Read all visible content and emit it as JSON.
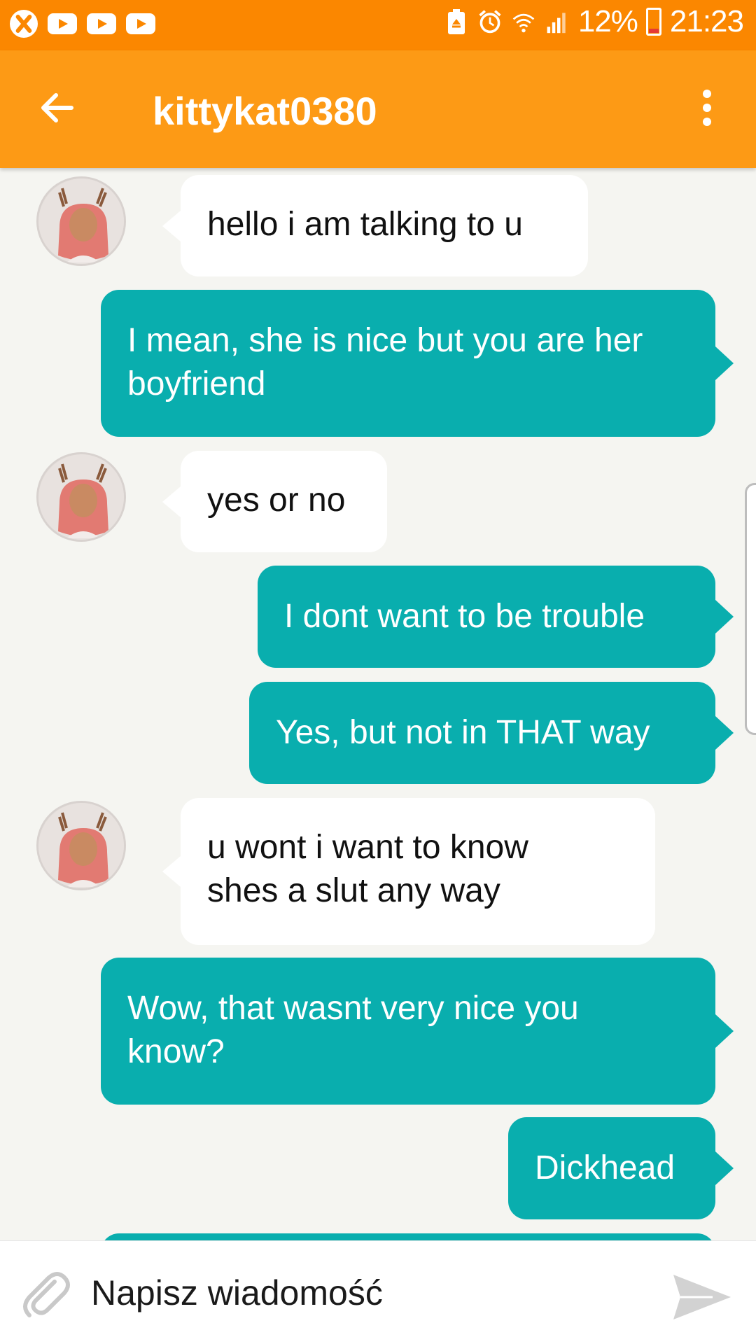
{
  "status_bar": {
    "battery_percent": "12%",
    "time": "21:23",
    "left_icons": [
      "xbox-icon",
      "youtube-icon",
      "youtube-icon",
      "youtube-icon"
    ],
    "right_icons": [
      "battery-saver-icon",
      "alarm-icon",
      "wifi-icon",
      "signal-icon",
      "battery-icon"
    ]
  },
  "header": {
    "title": "kittykat0380",
    "back_icon": "arrow-left-icon",
    "menu_icon": "more-vertical-icon"
  },
  "messages": [
    {
      "direction": "in",
      "text": "hello i am talking to u"
    },
    {
      "direction": "out",
      "text": "I mean, she is nice but you are her boyfriend"
    },
    {
      "direction": "in",
      "text": "yes or no"
    },
    {
      "direction": "out",
      "text": "I dont want to be trouble"
    },
    {
      "direction": "out",
      "text": "Yes, but not in THAT way"
    },
    {
      "direction": "in",
      "text": "u wont i want to know shes a slut any way"
    },
    {
      "direction": "out",
      "text": "Wow, that wasnt very nice you know?"
    },
    {
      "direction": "out",
      "text": "Dickhead"
    }
  ],
  "input": {
    "placeholder": "Napisz wiadomość",
    "attach_icon": "paperclip-icon",
    "send_icon": "send-icon"
  },
  "colors": {
    "status_bar": "#fb8700",
    "header": "#fd9a15",
    "outgoing_bubble": "#09aeae",
    "incoming_bubble": "#ffffff",
    "background": "#f5f5f1"
  }
}
